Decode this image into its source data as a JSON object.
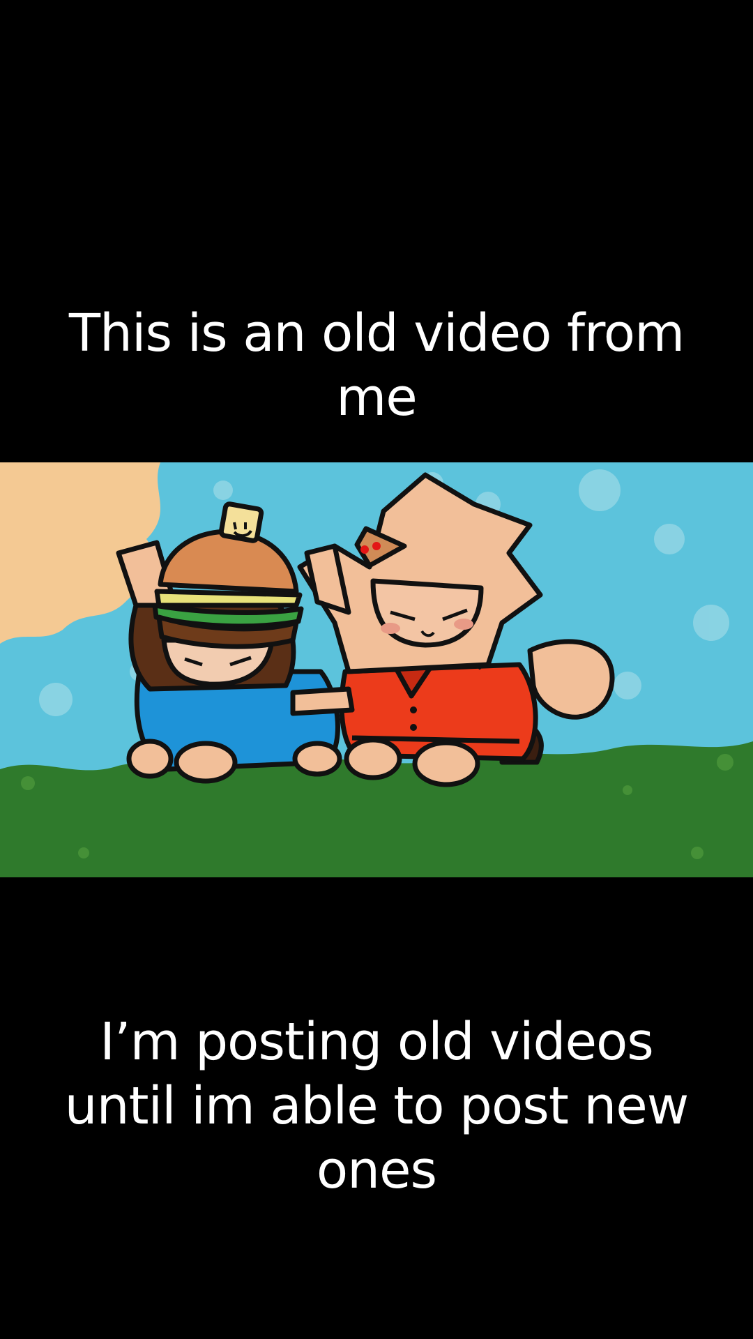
{
  "captions": {
    "top": "This is an old video from me",
    "bottom": "I’m posting old videos until im able to post new ones"
  },
  "scene": {
    "sky_color": "#5cc3dc",
    "sun_color": "#f4c993",
    "grass_color": "#2f7a2c",
    "characters": [
      {
        "name": "burger-hat-character",
        "shirt_color": "#1e93d8",
        "hair_color": "#5a2f16"
      },
      {
        "name": "pizza-shirt-character",
        "shirt_color": "#ec3b1b",
        "hair_color": "#f2bf8c"
      }
    ]
  }
}
